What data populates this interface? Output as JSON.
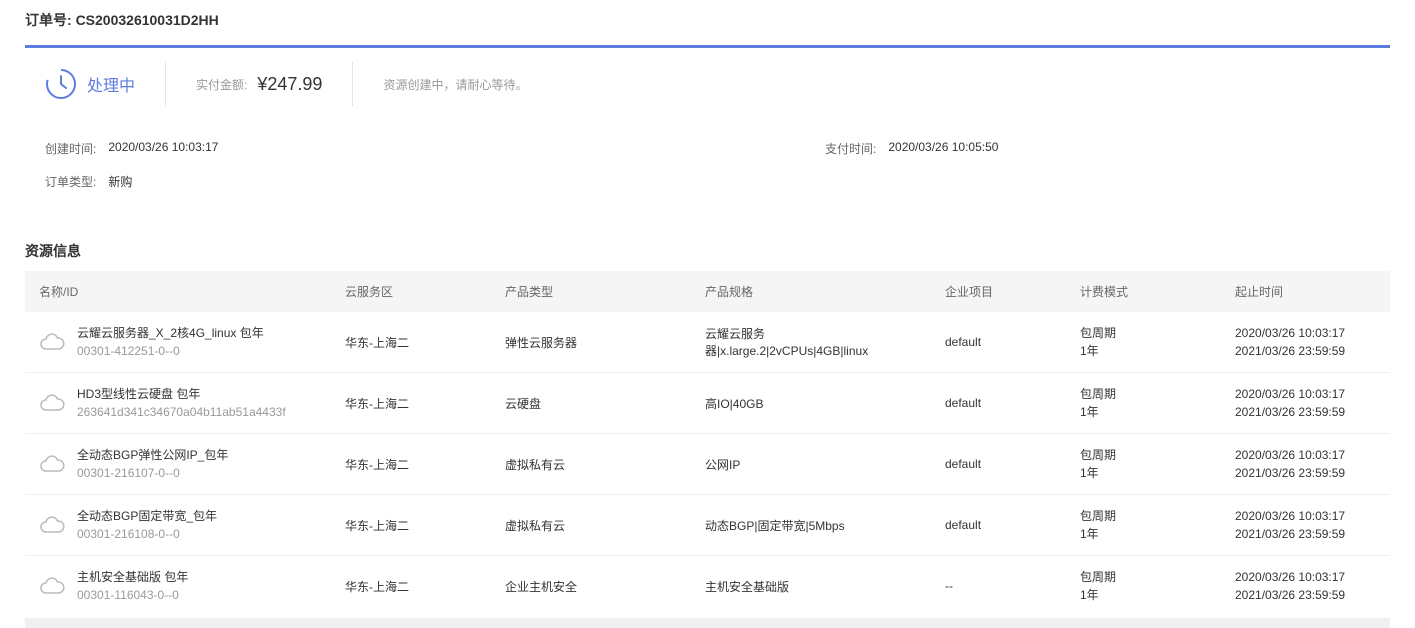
{
  "order_no_label": "订单号:",
  "order_no_value": "CS20032610031D2HH",
  "status": {
    "text": "处理中",
    "amount_label": "实付金额:",
    "amount_value": "¥247.99",
    "note": "资源创建中，请耐心等待。"
  },
  "meta": {
    "create_label": "创建时间:",
    "create_value": "2020/03/26 10:03:17",
    "pay_label": "支付时间:",
    "pay_value": "2020/03/26 10:05:50",
    "type_label": "订单类型:",
    "type_value": "新购"
  },
  "section_title": "资源信息",
  "headers": [
    "名称/ID",
    "云服务区",
    "产品类型",
    "产品规格",
    "企业项目",
    "计费模式",
    "起止时间"
  ],
  "rows": [
    {
      "name": "云耀云服务器_X_2核4G_linux 包年",
      "id": "00301-412251-0--0",
      "region": "华东-上海二",
      "ptype": "弹性云服务器",
      "spec": "云耀云服务器|x.large.2|2vCPUs|4GB|linux",
      "project": "default",
      "bill1": "包周期",
      "bill2": "1年",
      "t1": "2020/03/26 10:03:17",
      "t2": "2021/03/26 23:59:59"
    },
    {
      "name": "HD3型线性云硬盘 包年",
      "id": "263641d341c34670a04b11ab51a4433f",
      "region": "华东-上海二",
      "ptype": "云硬盘",
      "spec": "高IO|40GB",
      "project": "default",
      "bill1": "包周期",
      "bill2": "1年",
      "t1": "2020/03/26 10:03:17",
      "t2": "2021/03/26 23:59:59"
    },
    {
      "name": "全动态BGP弹性公网IP_包年",
      "id": "00301-216107-0--0",
      "region": "华东-上海二",
      "ptype": "虚拟私有云",
      "spec": "公网IP",
      "project": "default",
      "bill1": "包周期",
      "bill2": "1年",
      "t1": "2020/03/26 10:03:17",
      "t2": "2021/03/26 23:59:59"
    },
    {
      "name": "全动态BGP固定带宽_包年",
      "id": "00301-216108-0--0",
      "region": "华东-上海二",
      "ptype": "虚拟私有云",
      "spec": "动态BGP|固定带宽|5Mbps",
      "project": "default",
      "bill1": "包周期",
      "bill2": "1年",
      "t1": "2020/03/26 10:03:17",
      "t2": "2021/03/26 23:59:59"
    },
    {
      "name": "主机安全基础版 包年",
      "id": "00301-116043-0--0",
      "region": "华东-上海二",
      "ptype": "企业主机安全",
      "spec": "主机安全基础版",
      "project": "--",
      "bill1": "包周期",
      "bill2": "1年",
      "t1": "2020/03/26 10:03:17",
      "t2": "2021/03/26 23:59:59"
    }
  ]
}
